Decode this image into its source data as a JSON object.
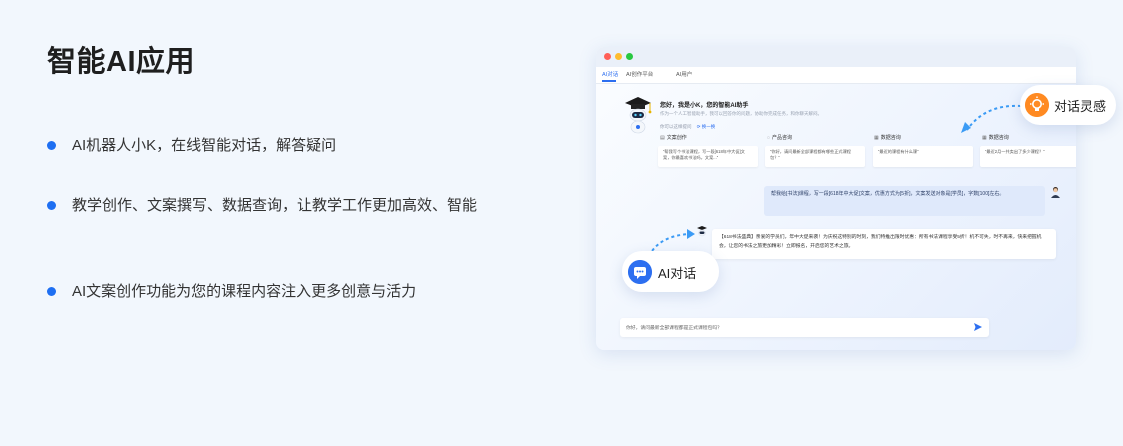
{
  "page": {
    "title": "智能AI应用"
  },
  "features": [
    {
      "text": "AI机器人小K，在线智能对话，解答疑问"
    },
    {
      "text": "教学创作、文案撰写、数据查询，让教学工作更加高效、智能"
    },
    {
      "text": "AI文案创作功能为您的课程内容注入更多创意与活力"
    }
  ],
  "window": {
    "tabs": [
      "AI对话",
      "AI创作平台",
      "AI用户"
    ],
    "greeting": {
      "title": "您好，我是小K，您的智能AI助手",
      "desc": "作为一个人工智能助手，我可以回答你的问题，协助你完成任务，和你聊天解闷。",
      "more_label": "你可以这样提问",
      "more_link": "换一换"
    },
    "categories": [
      {
        "label": "文案创作",
        "icon": "document-icon",
        "sample": "“帮我写个书法课程，写一段[618年中大促]文案，你最喜欢书法吗，文案...”"
      },
      {
        "label": "产品咨询",
        "icon": "chat-icon",
        "sample": "“你好，请问最新全部课程都有哪些正式课程包？”"
      },
      {
        "label": "数据咨询",
        "icon": "chart-icon",
        "sample": "“最近的课程有什么课”"
      },
      {
        "label": "数据咨询",
        "icon": "chart-icon",
        "sample": "“最近2月一共卖出了多少课程？”"
      }
    ],
    "user_message": "帮我给[书法]课程，写一段[618年中大促]文案，优惠方式为[5折]，文案发送对象是[学员]，字数[100]左右。",
    "bot_message": "【618书法盛典】亲爱的学员们，年中大促来袭！为庆祝这特别的时刻，我们特推出限时优惠：所有书法课程享受5折！机不可失，时不再来，快来把握机会，让您的书法之旅更加精彩！立即报名，开启您的艺术之旅。",
    "input_placeholder": "你好，请问最新全部课程都是正式课程包吗？",
    "send_icon": "send-icon"
  },
  "pills": {
    "inspiration": {
      "label": "对话灵感",
      "icon": "lightbulb-icon"
    },
    "chat": {
      "label": "AI对话",
      "icon": "chat-bubble-icon"
    }
  },
  "colors": {
    "accent": "#1e6ff2",
    "orange": "#ff8a22",
    "background": "#f2f7fd"
  }
}
